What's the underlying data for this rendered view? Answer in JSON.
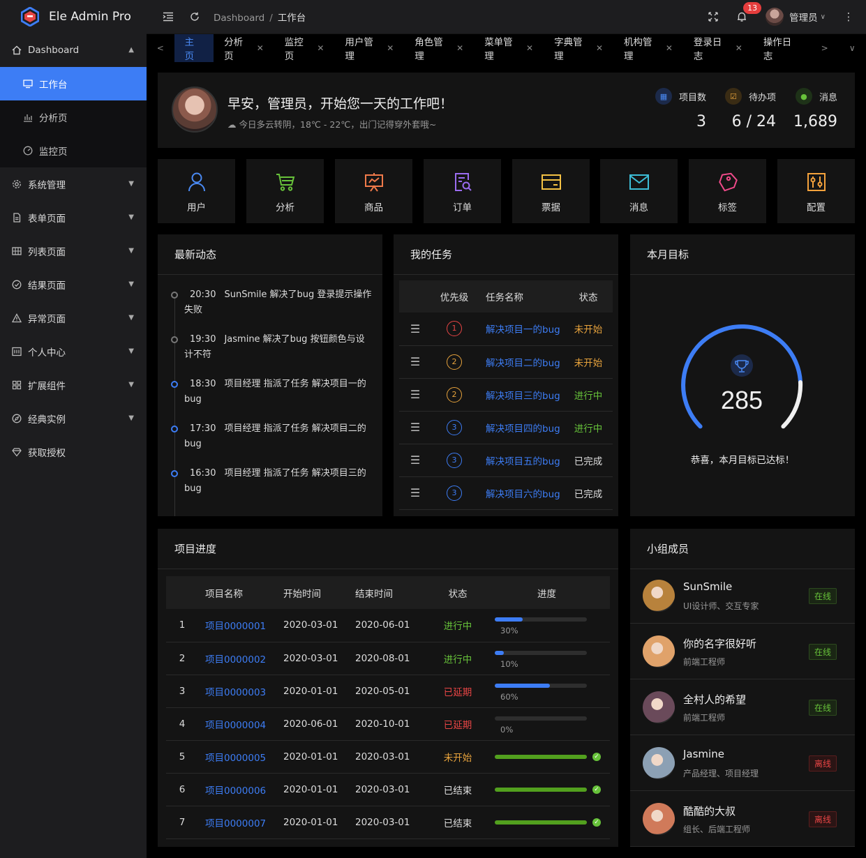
{
  "app": {
    "title": "Ele Admin Pro"
  },
  "sidebar": {
    "items": [
      {
        "label": "Dashboard",
        "icon": "home-icon",
        "expanded": true
      },
      {
        "label": "工作台",
        "icon": "monitor-icon",
        "active": true
      },
      {
        "label": "分析页",
        "icon": "bar-chart-icon"
      },
      {
        "label": "监控页",
        "icon": "dashboard-gauge-icon"
      },
      {
        "label": "系统管理",
        "icon": "gear-icon"
      },
      {
        "label": "表单页面",
        "icon": "document-icon"
      },
      {
        "label": "列表页面",
        "icon": "grid-icon"
      },
      {
        "label": "结果页面",
        "icon": "check-circle-icon"
      },
      {
        "label": "异常页面",
        "icon": "warning-icon"
      },
      {
        "label": "个人中心",
        "icon": "user-card-icon"
      },
      {
        "label": "扩展组件",
        "icon": "components-icon"
      },
      {
        "label": "经典实例",
        "icon": "compass-icon"
      },
      {
        "label": "获取授权",
        "icon": "diamond-icon"
      }
    ]
  },
  "header": {
    "breadcrumb": [
      "Dashboard",
      "工作台"
    ],
    "notification_count": "13",
    "user_name": "管理员"
  },
  "tabs": [
    {
      "label": "主页",
      "active": true,
      "closable": false
    },
    {
      "label": "分析页",
      "closable": true
    },
    {
      "label": "监控页",
      "closable": true
    },
    {
      "label": "用户管理",
      "closable": true
    },
    {
      "label": "角色管理",
      "closable": true
    },
    {
      "label": "菜单管理",
      "closable": true
    },
    {
      "label": "字典管理",
      "closable": true
    },
    {
      "label": "机构管理",
      "closable": true
    },
    {
      "label": "登录日志",
      "closable": true
    },
    {
      "label": "操作日志",
      "closable": false
    }
  ],
  "welcome": {
    "greeting": "早安，管理员，开始您一天的工作吧！",
    "weather": "今日多云转阴，18℃ - 22℃，出门记得穿外套哦~",
    "stats": [
      {
        "label": "项目数",
        "value": "3",
        "color": "#3d7df5"
      },
      {
        "label": "待办项",
        "value": "6 / 24",
        "color": "#e6a23c"
      },
      {
        "label": "消息",
        "value": "1,689",
        "color": "#67c23a"
      }
    ]
  },
  "shortcuts": [
    {
      "label": "用户",
      "icon": "user-icon",
      "color": "#4a8af4"
    },
    {
      "label": "分析",
      "icon": "cart-icon",
      "color": "#67c23a"
    },
    {
      "label": "商品",
      "icon": "presentation-icon",
      "color": "#f07a4a"
    },
    {
      "label": "订单",
      "icon": "order-search-icon",
      "color": "#9b6cf0"
    },
    {
      "label": "票据",
      "icon": "card-icon",
      "color": "#f5c244"
    },
    {
      "label": "消息",
      "icon": "mail-icon",
      "color": "#3dbdd6"
    },
    {
      "label": "标签",
      "icon": "tag-icon",
      "color": "#f04a8a"
    },
    {
      "label": "配置",
      "icon": "sliders-icon",
      "color": "#f5a23c"
    }
  ],
  "activity": {
    "title": "最新动态",
    "items": [
      {
        "time": "20:30",
        "text": "SunSmile 解决了bug 登录提示操作失败",
        "dot": "gray"
      },
      {
        "time": "19:30",
        "text": "Jasmine 解决了bug 按钮颜色与设计不符",
        "dot": "gray"
      },
      {
        "time": "18:30",
        "text": "项目经理 指派了任务 解决项目一的bug",
        "dot": "blue"
      },
      {
        "time": "17:30",
        "text": "项目经理 指派了任务 解决项目二的bug",
        "dot": "blue"
      },
      {
        "time": "16:30",
        "text": "项目经理 指派了任务 解决项目三的bug",
        "dot": "blue"
      }
    ]
  },
  "tasks": {
    "title": "我的任务",
    "columns": [
      "优先级",
      "任务名称",
      "状态"
    ],
    "rows": [
      {
        "priority": "1",
        "prio_color": "#e84545",
        "name": "解决项目一的bug",
        "status": "未开始",
        "status_class": "st-orange"
      },
      {
        "priority": "2",
        "prio_color": "#e6a23c",
        "name": "解决项目二的bug",
        "status": "未开始",
        "status_class": "st-orange"
      },
      {
        "priority": "2",
        "prio_color": "#e6a23c",
        "name": "解决项目三的bug",
        "status": "进行中",
        "status_class": "st-green"
      },
      {
        "priority": "3",
        "prio_color": "#3d7df5",
        "name": "解决项目四的bug",
        "status": "进行中",
        "status_class": "st-green"
      },
      {
        "priority": "3",
        "prio_color": "#3d7df5",
        "name": "解决项目五的bug",
        "status": "已完成",
        "status_class": "st-white"
      },
      {
        "priority": "3",
        "prio_color": "#3d7df5",
        "name": "解决项目六的bug",
        "status": "已完成",
        "status_class": "st-white"
      }
    ]
  },
  "goal": {
    "title": "本月目标",
    "value": "285",
    "message": "恭喜，本月目标已达标！",
    "percent": 100
  },
  "projects": {
    "title": "项目进度",
    "columns": [
      "项目名称",
      "开始时间",
      "结束时间",
      "状态",
      "进度"
    ],
    "rows": [
      {
        "idx": "1",
        "name": "项目0000001",
        "start": "2020-03-01",
        "end": "2020-06-01",
        "status": "进行中",
        "status_class": "st-green",
        "progress": 30,
        "bar_color": "#3d7df5",
        "pct": "30%"
      },
      {
        "idx": "2",
        "name": "项目0000002",
        "start": "2020-03-01",
        "end": "2020-08-01",
        "status": "进行中",
        "status_class": "st-green",
        "progress": 10,
        "bar_color": "#3d7df5",
        "pct": "10%"
      },
      {
        "idx": "3",
        "name": "项目0000003",
        "start": "2020-01-01",
        "end": "2020-05-01",
        "status": "已延期",
        "status_class": "st-red",
        "progress": 60,
        "bar_color": "#3d7df5",
        "pct": "60%"
      },
      {
        "idx": "4",
        "name": "项目0000004",
        "start": "2020-06-01",
        "end": "2020-10-01",
        "status": "已延期",
        "status_class": "st-red",
        "progress": 0,
        "bar_color": "#3d7df5",
        "pct": "0%"
      },
      {
        "idx": "5",
        "name": "项目0000005",
        "start": "2020-01-01",
        "end": "2020-03-01",
        "status": "未开始",
        "status_class": "st-orange",
        "progress": 100,
        "bar_color": "#52a01e",
        "pct": ""
      },
      {
        "idx": "6",
        "name": "项目0000006",
        "start": "2020-01-01",
        "end": "2020-03-01",
        "status": "已结束",
        "status_class": "st-white",
        "progress": 100,
        "bar_color": "#52a01e",
        "pct": ""
      },
      {
        "idx": "7",
        "name": "项目0000007",
        "start": "2020-01-01",
        "end": "2020-03-01",
        "status": "已结束",
        "status_class": "st-white",
        "progress": 100,
        "bar_color": "#52a01e",
        "pct": ""
      }
    ]
  },
  "members": {
    "title": "小组成员",
    "items": [
      {
        "name": "SunSmile",
        "desc": "UI设计师、交互专家",
        "status": "在线",
        "online": true,
        "avatar_color": "#b8823c"
      },
      {
        "name": "你的名字很好听",
        "desc": "前端工程师",
        "status": "在线",
        "online": true,
        "avatar_color": "#e0a26a"
      },
      {
        "name": "全村人的希望",
        "desc": "前端工程师",
        "status": "在线",
        "online": true,
        "avatar_color": "#6a4a5a"
      },
      {
        "name": "Jasmine",
        "desc": "产品经理、项目经理",
        "status": "离线",
        "online": false,
        "avatar_color": "#8ca0b4"
      },
      {
        "name": "酷酷的大叔",
        "desc": "组长、后端工程师",
        "status": "离线",
        "online": false,
        "avatar_color": "#d07a5a"
      }
    ]
  }
}
